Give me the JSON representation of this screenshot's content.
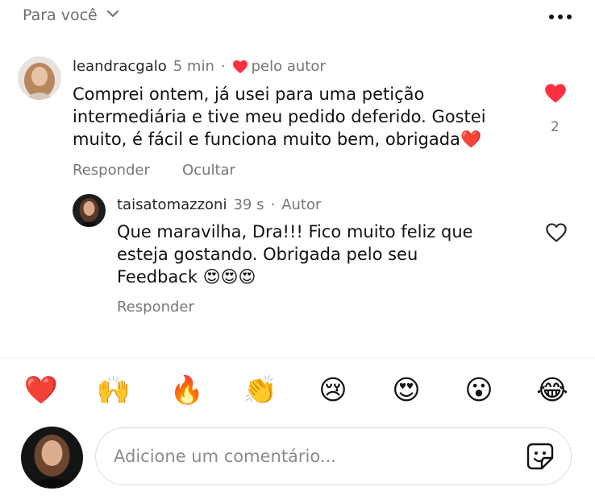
{
  "header": {
    "filter_label": "Para você",
    "more_icon": "more-horizontal-icon"
  },
  "comment": {
    "username": "leandracgalo",
    "time": "5 min",
    "separator": "·",
    "liked_by_author_label": "pelo autor",
    "text": "Comprei ontem, já usei para uma petição intermediária e tive meu pedido deferido. Gostei muito, é fácil e funciona muito bem, obrigada",
    "text_emoji": "❤️",
    "reply_label": "Responder",
    "hide_label": "Ocultar",
    "like_count": "2",
    "liked": true
  },
  "reply": {
    "username": "taisatomazzoni",
    "time": "39 s",
    "separator": "·",
    "author_label": "Autor",
    "text": "Que maravilha, Dra!!! Fico muito feliz que esteja gostando. Obrigada pelo seu Feedback",
    "text_emoji": "😍😍😍",
    "reply_label": "Responder",
    "liked": false
  },
  "quick_reactions": [
    "❤️",
    "🙌",
    "🔥",
    "👏",
    "😢",
    "😍",
    "😮",
    "😂"
  ],
  "composer": {
    "placeholder": "Adicione um comentário...",
    "sticker_icon": "sticker-icon"
  },
  "colors": {
    "like_red": "#ff3040",
    "muted_text": "#777777"
  }
}
